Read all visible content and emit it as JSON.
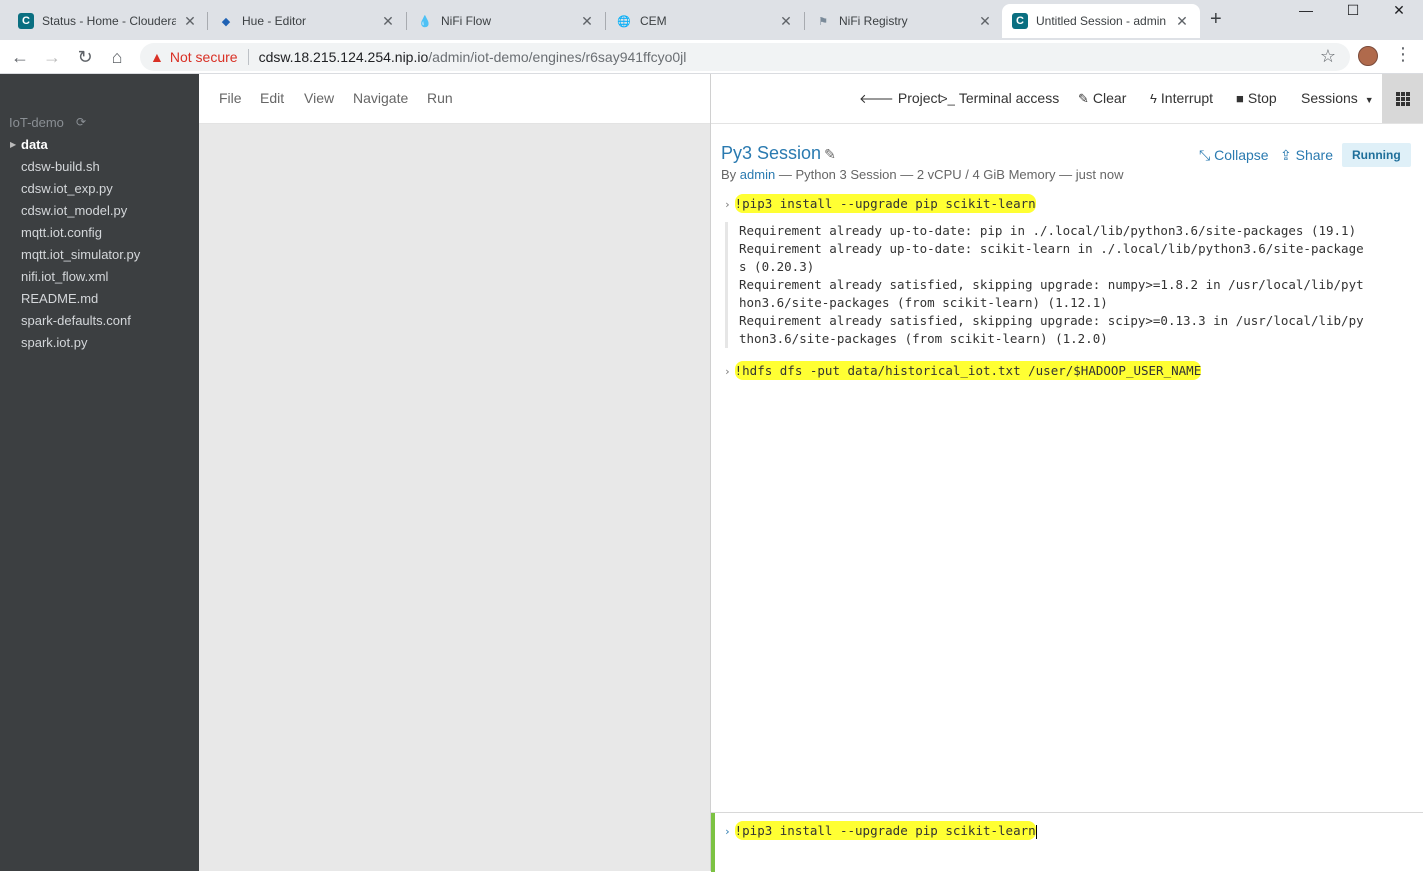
{
  "browser": {
    "tabs": [
      {
        "title": "Status - Home - Cloudera",
        "favicon": "C"
      },
      {
        "title": "Hue - Editor",
        "favicon": "hue-logo"
      },
      {
        "title": "NiFi Flow",
        "favicon": "nifi-logo"
      },
      {
        "title": "CEM",
        "favicon": "globe"
      },
      {
        "title": "NiFi Registry",
        "favicon": "registry-logo"
      },
      {
        "title": "Untitled Session - admin /",
        "favicon": "C"
      }
    ],
    "security_label": "Not secure",
    "url_host": "cdsw.18.215.124.254.nip.io",
    "url_path": "/admin/iot-demo/engines/r6say941ffcyo0jl"
  },
  "sidebar": {
    "project": "IoT-demo",
    "items": [
      {
        "label": "data",
        "type": "folder"
      },
      {
        "label": "cdsw-build.sh"
      },
      {
        "label": "cdsw.iot_exp.py"
      },
      {
        "label": "cdsw.iot_model.py"
      },
      {
        "label": "mqtt.iot.config"
      },
      {
        "label": "mqtt.iot_simulator.py"
      },
      {
        "label": "nifi.iot_flow.xml"
      },
      {
        "label": "README.md"
      },
      {
        "label": "spark-defaults.conf"
      },
      {
        "label": "spark.iot.py"
      }
    ]
  },
  "editor_menu": {
    "file": "File",
    "edit": "Edit",
    "view": "View",
    "navigate": "Navigate",
    "run": "Run"
  },
  "toolbar": {
    "project": "Project",
    "terminal": "Terminal access",
    "clear": "Clear",
    "interrupt": "Interrupt",
    "stop": "Stop",
    "sessions": "Sessions"
  },
  "session": {
    "title": "Py3 Session",
    "by": "By",
    "user": "admin",
    "meta": " — Python 3 Session — 2 vCPU / 4 GiB Memory — just now",
    "collapse": "Collapse",
    "share": "Share",
    "status": "Running",
    "commands": [
      "!pip3 install --upgrade pip scikit-learn",
      "!hdfs dfs -put data/historical_iot.txt /user/$HADOOP_USER_NAME"
    ],
    "output": [
      "Requirement already up-to-date: pip in ./.local/lib/python3.6/site-packages (19.1)",
      "Requirement already up-to-date: scikit-learn in ./.local/lib/python3.6/site-package",
      "s (0.20.3)",
      "Requirement already satisfied, skipping upgrade: numpy>=1.8.2 in /usr/local/lib/pyt",
      "hon3.6/site-packages (from scikit-learn) (1.12.1)",
      "Requirement already satisfied, skipping upgrade: scipy>=0.13.3 in /usr/local/lib/py",
      "thon3.6/site-packages (from scikit-learn) (1.2.0)"
    ],
    "input_value": "!pip3 install --upgrade pip scikit-learn"
  },
  "colors": {
    "accent": "#2a7ab0",
    "highlight": "#ffff33",
    "sidebar": "#3c3f41",
    "input_accent": "#7cc243"
  }
}
